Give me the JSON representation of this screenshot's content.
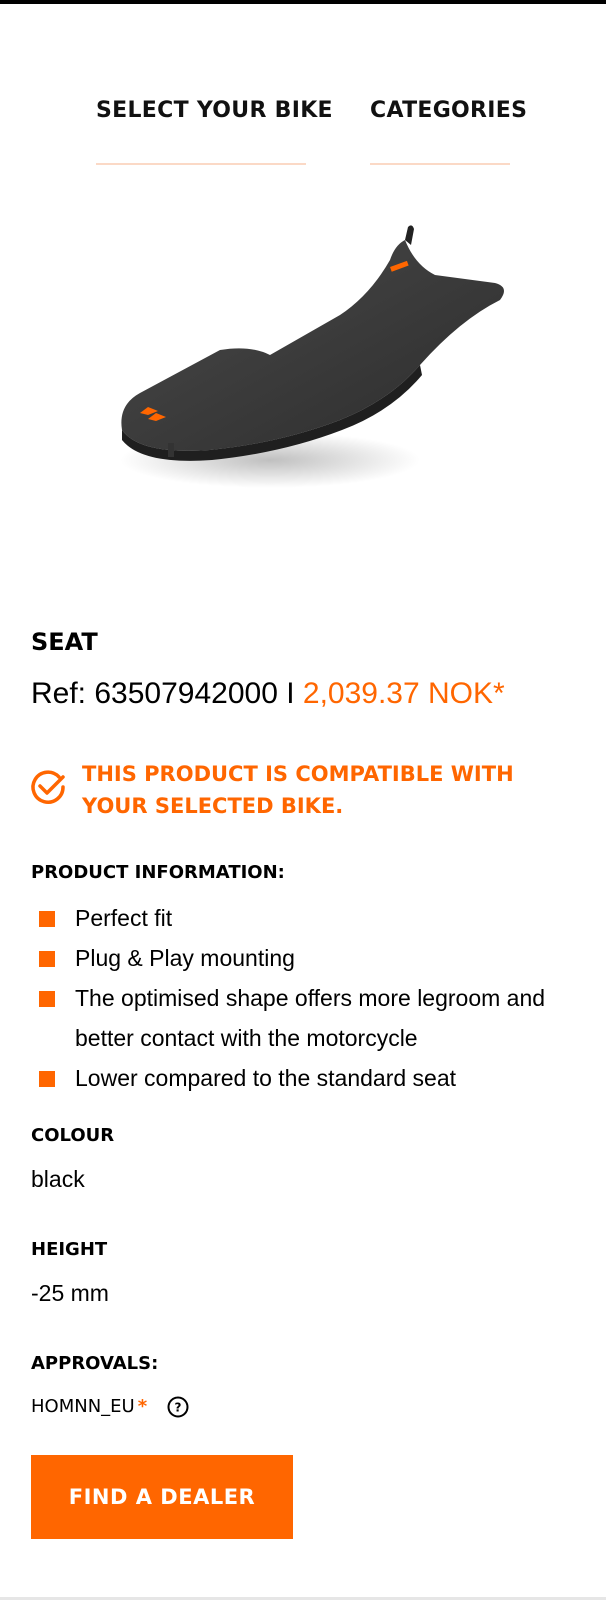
{
  "nav": {
    "select_bike": "SELECT YOUR BIKE",
    "categories": "CATEGORIES"
  },
  "product": {
    "title": "SEAT",
    "ref_label": "Ref: 63507942000 I ",
    "price": "2,039.37 NOK*",
    "compatibility": "THIS PRODUCT IS COMPATIBLE WITH YOUR SELECTED BIKE.",
    "info_label": "PRODUCT INFORMATION:",
    "features": [
      "Perfect fit",
      "Plug & Play mounting",
      "The optimised shape offers more legroom and better contact with the motorcycle",
      "Lower compared to the standard seat"
    ],
    "colour_label": "COLOUR",
    "colour_value": "black",
    "height_label": "HEIGHT",
    "height_value": "-25 mm",
    "approvals_label": "APPROVALS:",
    "approval_code": "HOMNN_EU",
    "approval_star": "*"
  },
  "actions": {
    "find_dealer": "FIND A DEALER"
  },
  "colors": {
    "accent": "#ff6600",
    "nav_underline": "#fbd9c6"
  },
  "icons": {
    "compatibility": "check-circle-icon",
    "help": "question-circle-icon"
  }
}
